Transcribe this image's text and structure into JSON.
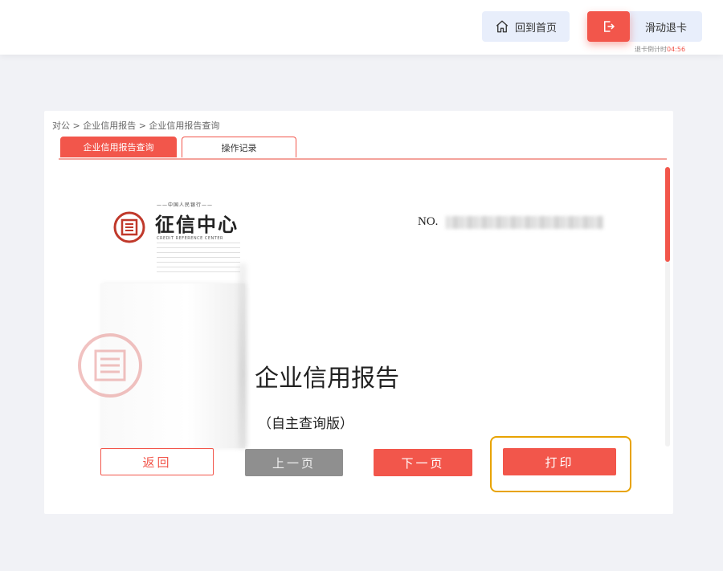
{
  "header": {
    "home_label": "回到首页",
    "exit_label": "滑动退卡",
    "countdown_prefix": "退卡倒计时",
    "countdown_time": "04:56"
  },
  "breadcrumb": "对公 > 企业信用报告 > 企业信用报告查询",
  "tabs": [
    {
      "label": "企业信用报告查询",
      "active": true
    },
    {
      "label": "操作记录",
      "active": false
    }
  ],
  "report": {
    "org_small_top": "——中国人民银行——",
    "org_title": "征信中心",
    "org_sub": "CREDIT REFERENCE CENTER",
    "no_label": "NO.",
    "title": "企业信用报告",
    "subtitle": "（自主查询版）"
  },
  "buttons": {
    "back": "返回",
    "prev": "上一页",
    "next": "下一页",
    "print": "打印"
  },
  "colors": {
    "accent": "#f2564b",
    "focus": "#e8a300",
    "disabled": "#8f8f8f"
  },
  "icons": {
    "home": "home-icon",
    "exit": "exit-icon"
  }
}
